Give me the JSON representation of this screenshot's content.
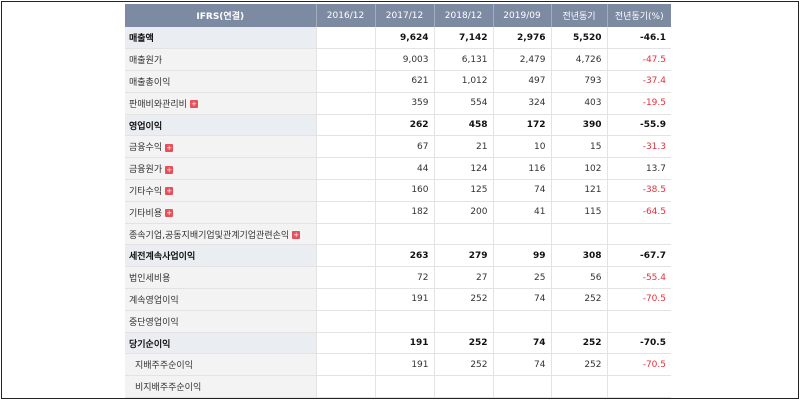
{
  "header": [
    "IFRS(연결)",
    "2016/12",
    "2017/12",
    "2018/12",
    "2019/09",
    "전년동기",
    "전년동기(%)"
  ],
  "rows": [
    {
      "label": "매출액",
      "bold": true,
      "expand": false,
      "indent": false,
      "cells": [
        "",
        "9,624",
        "7,142",
        "2,976",
        "5,520",
        "-46.1"
      ]
    },
    {
      "label": "매출원가",
      "bold": false,
      "expand": false,
      "indent": false,
      "cells": [
        "",
        "9,003",
        "6,131",
        "2,479",
        "4,726",
        "-47.5"
      ]
    },
    {
      "label": "매출총이익",
      "bold": false,
      "expand": false,
      "indent": false,
      "cells": [
        "",
        "621",
        "1,012",
        "497",
        "793",
        "-37.4"
      ]
    },
    {
      "label": "판매비와관리비",
      "bold": false,
      "expand": true,
      "indent": false,
      "cells": [
        "",
        "359",
        "554",
        "324",
        "403",
        "-19.5"
      ]
    },
    {
      "label": "영업이익",
      "bold": true,
      "expand": false,
      "indent": false,
      "cells": [
        "",
        "262",
        "458",
        "172",
        "390",
        "-55.9"
      ]
    },
    {
      "label": "금융수익",
      "bold": false,
      "expand": true,
      "indent": false,
      "cells": [
        "",
        "67",
        "21",
        "10",
        "15",
        "-31.3"
      ]
    },
    {
      "label": "금융원가",
      "bold": false,
      "expand": true,
      "indent": false,
      "cells": [
        "",
        "44",
        "124",
        "116",
        "102",
        "13.7"
      ]
    },
    {
      "label": "기타수익",
      "bold": false,
      "expand": true,
      "indent": false,
      "cells": [
        "",
        "160",
        "125",
        "74",
        "121",
        "-38.5"
      ]
    },
    {
      "label": "기타비용",
      "bold": false,
      "expand": true,
      "indent": false,
      "cells": [
        "",
        "182",
        "200",
        "41",
        "115",
        "-64.5"
      ]
    },
    {
      "label": "종속기업,공동지배기업및관계기업관련손익",
      "bold": false,
      "expand": true,
      "indent": false,
      "cells": [
        "",
        "",
        "",
        "",
        "",
        ""
      ]
    },
    {
      "label": "세전계속사업이익",
      "bold": true,
      "expand": false,
      "indent": false,
      "cells": [
        "",
        "263",
        "279",
        "99",
        "308",
        "-67.7"
      ]
    },
    {
      "label": "법인세비용",
      "bold": false,
      "expand": false,
      "indent": false,
      "cells": [
        "",
        "72",
        "27",
        "25",
        "56",
        "-55.4"
      ]
    },
    {
      "label": "계속영업이익",
      "bold": false,
      "expand": false,
      "indent": false,
      "cells": [
        "",
        "191",
        "252",
        "74",
        "252",
        "-70.5"
      ]
    },
    {
      "label": "중단영업이익",
      "bold": false,
      "expand": false,
      "indent": false,
      "cells": [
        "",
        "",
        "",
        "",
        "",
        ""
      ]
    },
    {
      "label": "당기순이익",
      "bold": true,
      "expand": false,
      "indent": false,
      "cells": [
        "",
        "191",
        "252",
        "74",
        "252",
        "-70.5"
      ]
    },
    {
      "label": "지배주주순이익",
      "bold": false,
      "expand": false,
      "indent": true,
      "cells": [
        "",
        "191",
        "252",
        "74",
        "252",
        "-70.5"
      ]
    },
    {
      "label": "비지배주주순이익",
      "bold": false,
      "expand": false,
      "indent": true,
      "cells": [
        "",
        "",
        "",
        "",
        "",
        ""
      ]
    }
  ],
  "icons": {
    "expand": "plus-icon",
    "expand_glyph": "+"
  },
  "colors": {
    "header_bg": "#7c8aa2",
    "negative": "#e0333f",
    "label_bg": "#f3f3f3"
  }
}
